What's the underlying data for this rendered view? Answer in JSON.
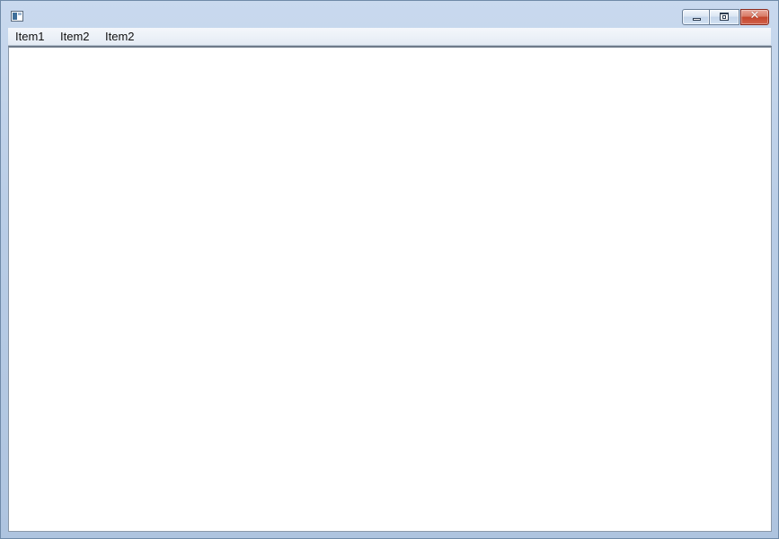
{
  "window": {
    "title": ""
  },
  "titlebar": {
    "icon": "app-window-icon",
    "controls": {
      "minimize_icon": "minimize-icon",
      "maximize_icon": "maximize-icon",
      "close_icon": "close-icon",
      "close_glyph": "✕"
    }
  },
  "menubar": {
    "items": [
      {
        "label": "Item1"
      },
      {
        "label": "Item2"
      },
      {
        "label": "Item2"
      }
    ]
  },
  "colors": {
    "close_button": "#c3452c",
    "frame": "#b9cde6",
    "client": "#ffffff"
  }
}
